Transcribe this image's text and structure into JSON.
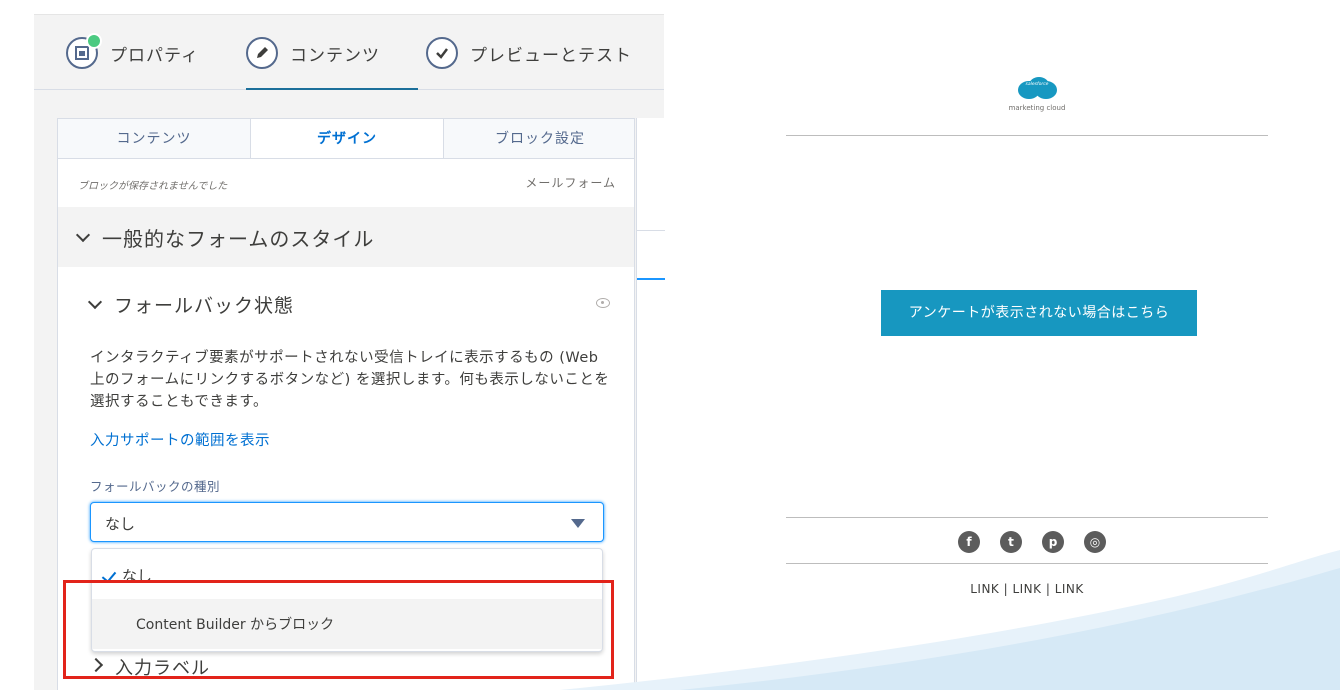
{
  "top_tabs": [
    {
      "label": "プロパティ"
    },
    {
      "label": "コンテンツ"
    },
    {
      "label": "プレビューとテスト"
    }
  ],
  "sub_tabs": [
    {
      "label": "コンテンツ"
    },
    {
      "label": "デザイン"
    },
    {
      "label": "ブロック設定"
    }
  ],
  "status": {
    "left": "ブロックが保存されませんでした",
    "right": "メールフォーム"
  },
  "section_general": {
    "title": "一般的なフォームのスタイル"
  },
  "section_fallback": {
    "title": "フォールバック状態",
    "description": "インタラクティブ要素がサポートされない受信トレイに表示するもの (Web 上のフォームにリンクするボタンなど) を選択します。何も表示しないことを選択することもできます。",
    "help_link": "入力サポートの範囲を表示",
    "type_label": "フォールバックの種別",
    "selected": "なし",
    "options": [
      {
        "label": "なし"
      },
      {
        "label": "Content Builder からブロック"
      }
    ]
  },
  "section_input_label": {
    "title": "入力ラベル"
  },
  "email_preview": {
    "logo_text": "marketing cloud",
    "logo_cloud_text": "salesforce",
    "cta_label": "アンケートが表示されない場合はこちら",
    "social_icons": [
      "facebook-icon",
      "twitter-icon",
      "pinterest-icon",
      "instagram-icon"
    ],
    "links": "LINK  |  LINK  |  LINK"
  },
  "colors": {
    "accent": "#0070d2",
    "cta": "#1797c0",
    "highlight": "#e2231a"
  }
}
